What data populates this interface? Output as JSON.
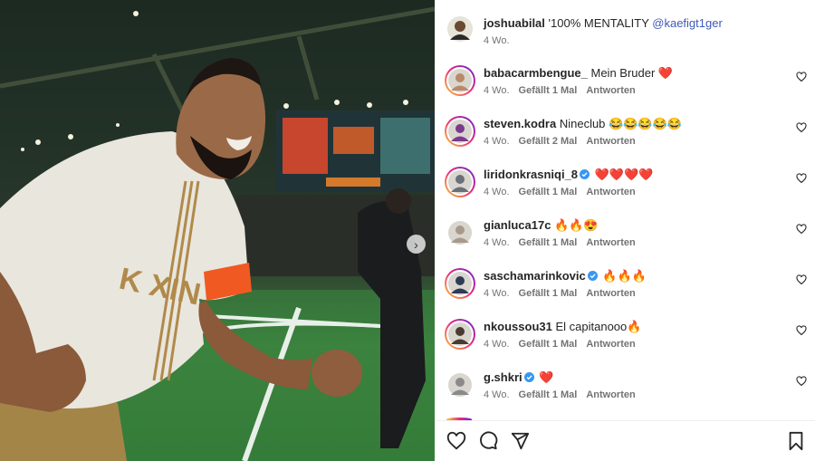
{
  "caption": {
    "user": "joshuabilal",
    "text": "'100% MENTALITY",
    "mention": "@kaefigt1ger",
    "time": "4 Wo."
  },
  "comments": [
    {
      "user": "babacarmbengue_",
      "text": "Mein Bruder ❤️",
      "verified": false,
      "time": "4 Wo.",
      "likes": "Gefällt 1 Mal",
      "reply": "Antworten",
      "avatar_color": "#b88a6a",
      "ring": true
    },
    {
      "user": "steven.kodra",
      "text": "Nineclub 😂😂😂😂😂",
      "verified": false,
      "time": "4 Wo.",
      "likes": "Gefällt 2 Mal",
      "reply": "Antworten",
      "avatar_color": "#7b3a8c",
      "ring": true
    },
    {
      "user": "liridonkrasniqi_8",
      "text": "❤️❤️❤️❤️",
      "verified": true,
      "time": "4 Wo.",
      "likes": "Gefällt 1 Mal",
      "reply": "Antworten",
      "avatar_color": "#6a6f78",
      "ring": true
    },
    {
      "user": "gianluca17c",
      "text": "🔥🔥😍",
      "verified": false,
      "time": "4 Wo.",
      "likes": "Gefällt 1 Mal",
      "reply": "Antworten",
      "avatar_color": "#a89a8a",
      "ring": false
    },
    {
      "user": "saschamarinkovic",
      "text": "🔥🔥🔥",
      "verified": true,
      "time": "4 Wo.",
      "likes": "Gefällt 1 Mal",
      "reply": "Antworten",
      "avatar_color": "#2f3b55",
      "ring": true
    },
    {
      "user": "nkoussou31",
      "text": "El capitanooo🔥",
      "verified": false,
      "time": "4 Wo.",
      "likes": "Gefällt 1 Mal",
      "reply": "Antworten",
      "avatar_color": "#4a3b30",
      "ring": true
    },
    {
      "user": "g.shkri",
      "text": "❤️",
      "verified": true,
      "time": "4 Wo.",
      "likes": "Gefällt 1 Mal",
      "reply": "Antworten",
      "avatar_color": "#8a8a8a",
      "ring": false
    }
  ],
  "icons": {
    "like": "heart-icon",
    "comment": "comment-icon",
    "share": "share-icon",
    "save": "bookmark-icon",
    "next": "chevron-right-icon"
  },
  "colors": {
    "verified": "#3897f0",
    "mention": "#3f5ab6",
    "jersey_gold": "#b08a4a",
    "captain_band": "#f05a22"
  }
}
